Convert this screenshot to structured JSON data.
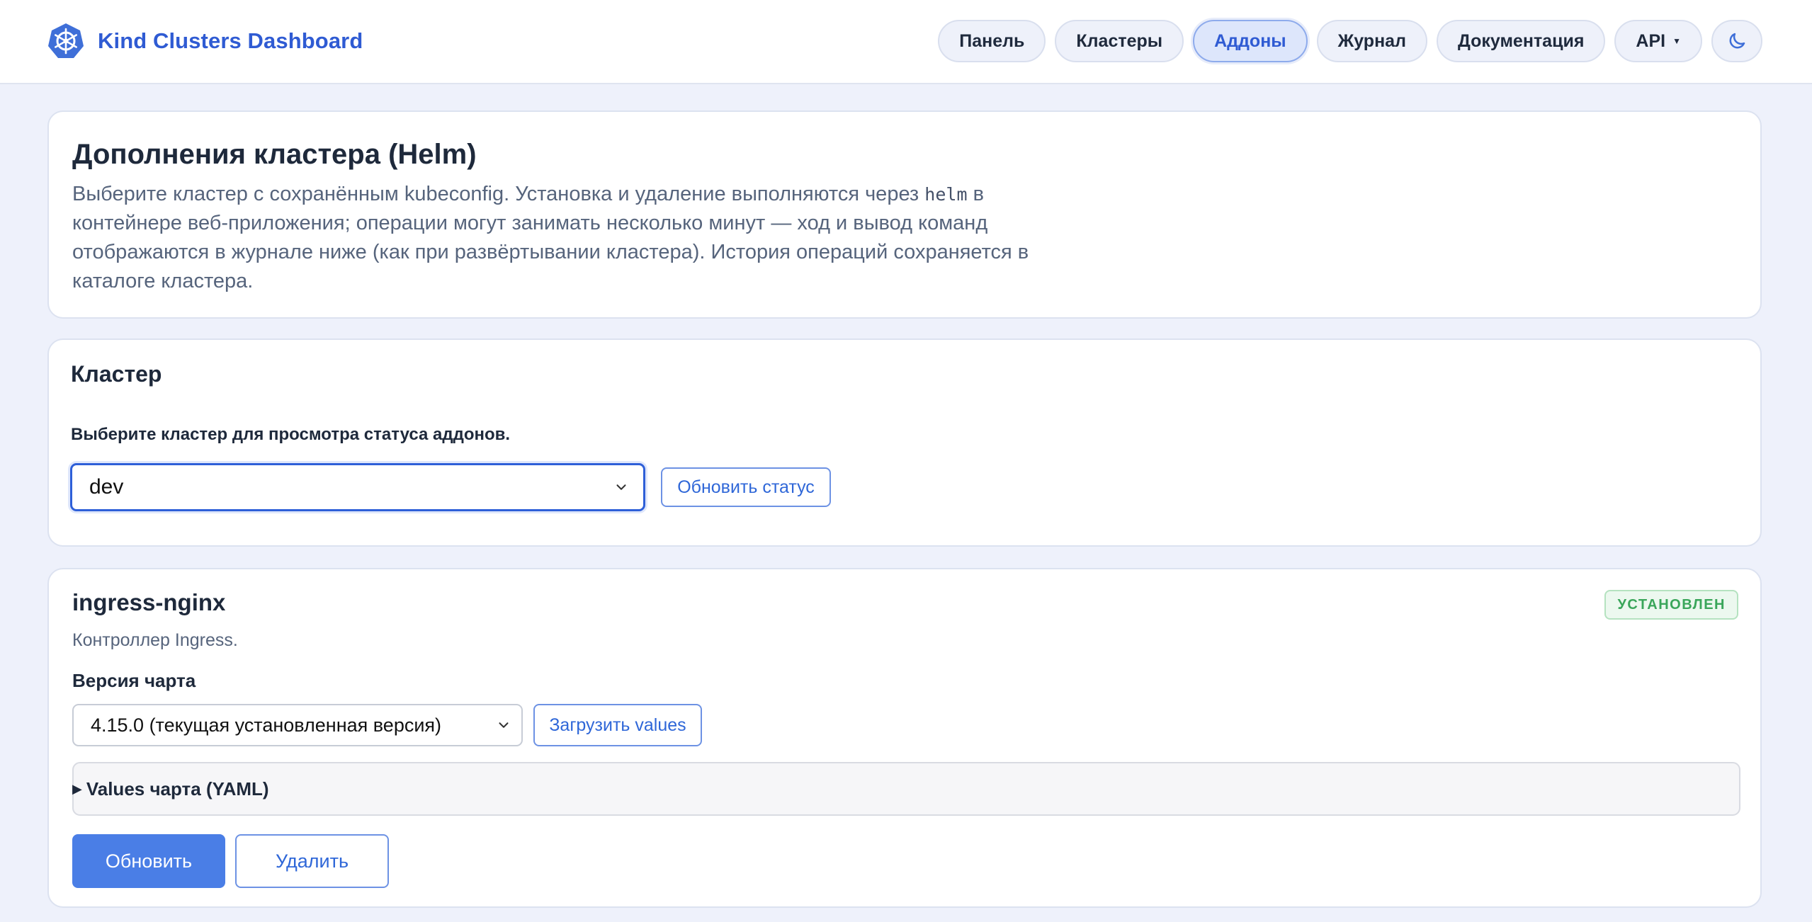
{
  "header": {
    "brand_title": "Kind Clusters Dashboard",
    "logo_icon": "kubernetes-helm-icon",
    "nav": [
      {
        "label": "Панель"
      },
      {
        "label": "Кластеры"
      },
      {
        "label": "Аддоны",
        "active": true
      },
      {
        "label": "Журнал"
      },
      {
        "label": "Документация"
      },
      {
        "label": "API",
        "has_dropdown": true
      }
    ],
    "theme_toggle_icon": "moon-icon"
  },
  "intro": {
    "title": "Дополнения кластера (Helm)",
    "text_before_code": "Выберите кластер с сохранённым kubeconfig. Установка и удаление выполняются через ",
    "code": "helm",
    "text_after_code": " в контейнере веб-приложения; операции могут занимать несколько минут — ход и вывод команд отображаются в журнале ниже (как при развёртывании кластера). История операций сохраняется в каталоге кластера."
  },
  "cluster": {
    "title": "Кластер",
    "label": "Выберите кластер для просмотра статуса аддонов.",
    "selected": "dev",
    "refresh_label": "Обновить статус"
  },
  "addon": {
    "name": "ingress-nginx",
    "status": "УСТАНОВЛЕН",
    "description": "Контроллер Ingress.",
    "chart_version_label": "Версия чарта",
    "chart_version_selected": "4.15.0 (текущая установленная версия)",
    "load_values_label": "Загрузить values",
    "values_summary": "Values чарта (YAML)",
    "update_label": "Обновить",
    "delete_label": "Удалить"
  },
  "colors": {
    "accent": "#2f5bd3",
    "primary_button": "#4a7ee6",
    "status_installed": "#3aa65a",
    "background": "#eef1fb"
  }
}
